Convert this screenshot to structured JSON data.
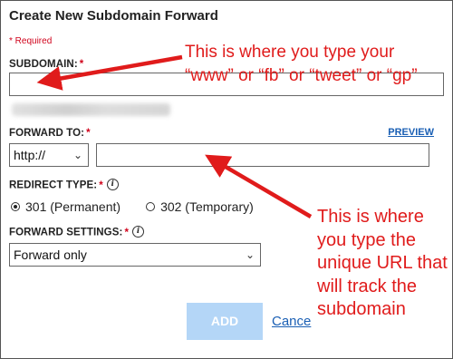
{
  "dialog": {
    "title": "Create New Subdomain Forward",
    "required_note": "* Required"
  },
  "subdomain": {
    "label": "SUBDOMAIN:",
    "required_marker": "*",
    "value": ""
  },
  "forward_to": {
    "label": "FORWARD TO:",
    "required_marker": "*",
    "protocol_selected": "http://",
    "url_value": "",
    "preview_link": "PREVIEW"
  },
  "redirect_type": {
    "label": "REDIRECT TYPE:",
    "required_marker": "*",
    "options": [
      {
        "label": "301 (Permanent)",
        "checked": true
      },
      {
        "label": "302 (Temporary)",
        "checked": false
      }
    ]
  },
  "forward_settings": {
    "label": "FORWARD SETTINGS:",
    "required_marker": "*",
    "selected": "Forward only"
  },
  "actions": {
    "add_label": "ADD",
    "cancel_label": "Cance"
  },
  "annotations": {
    "subdomain_note": "This is where you type your “www” or “fb” or “tweet” or “gp”",
    "forward_note": "This is where you type the unique URL that will track the subdomain",
    "color": "#e01b1b"
  },
  "colors": {
    "required": "#d0021b",
    "link": "#1a5fb4",
    "add_button_bg": "#b4d6f7"
  },
  "icons": {
    "info": "info-icon",
    "chevron": "chevron-down-icon"
  }
}
